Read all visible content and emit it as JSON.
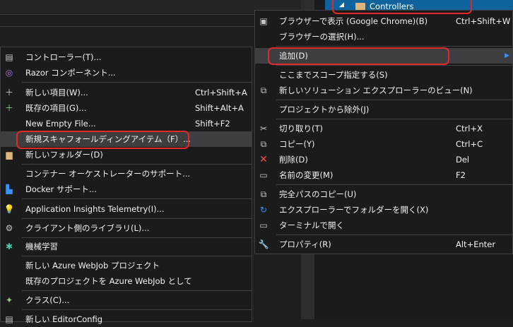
{
  "solution_explorer": {
    "selected_item": "Controllers"
  },
  "context_menu": {
    "items": [
      {
        "label": "ブラウザーで表示 (Google Chrome)(B)",
        "shortcut": "Ctrl+Shift+W",
        "icon": "browser-icon"
      },
      {
        "label": "ブラウザーの選択(H)...",
        "shortcut": "",
        "icon": ""
      },
      {
        "label": "追加(D)",
        "shortcut": "",
        "icon": "",
        "submenu": true
      },
      {
        "label": "ここまでスコープ指定する(S)",
        "shortcut": "",
        "icon": ""
      },
      {
        "label": "新しいソリューション エクスプローラーのビュー(N)",
        "shortcut": "",
        "icon": "new-view-icon"
      },
      {
        "label": "プロジェクトから除外(J)",
        "shortcut": "",
        "icon": ""
      },
      {
        "label": "切り取り(T)",
        "shortcut": "Ctrl+X",
        "icon": "scissors-icon"
      },
      {
        "label": "コピー(Y)",
        "shortcut": "Ctrl+C",
        "icon": "copy-icon"
      },
      {
        "label": "削除(D)",
        "shortcut": "Del",
        "icon": "delete-icon"
      },
      {
        "label": "名前の変更(M)",
        "shortcut": "F2",
        "icon": "rename-icon"
      },
      {
        "label": "完全パスのコピー(U)",
        "shortcut": "",
        "icon": "copy-path-icon"
      },
      {
        "label": "エクスプローラーでフォルダーを開く(X)",
        "shortcut": "",
        "icon": "refresh-icon"
      },
      {
        "label": "ターミナルで開く",
        "shortcut": "",
        "icon": "terminal-icon"
      },
      {
        "label": "プロパティ(R)",
        "shortcut": "Alt+Enter",
        "icon": "wrench-icon"
      }
    ]
  },
  "add_submenu": {
    "items": [
      {
        "label": "コントローラー(T)...",
        "shortcut": "",
        "icon": "controller-icon"
      },
      {
        "label": "Razor コンポーネント...",
        "shortcut": "",
        "icon": "razor-icon"
      },
      {
        "label": "新しい項目(W)...",
        "shortcut": "Ctrl+Shift+A",
        "icon": "new-item-icon"
      },
      {
        "label": "既存の項目(G)...",
        "shortcut": "Shift+Alt+A",
        "icon": "existing-item-icon"
      },
      {
        "label": "New Empty File...",
        "shortcut": "Shift+F2",
        "icon": ""
      },
      {
        "label": "新規スキャフォールディングアイテム（F）...",
        "shortcut": "",
        "icon": ""
      },
      {
        "label": "新しいフォルダー(D)",
        "shortcut": "",
        "icon": "new-folder-icon"
      },
      {
        "label": "コンテナー オーケストレーターのサポート...",
        "shortcut": "",
        "icon": ""
      },
      {
        "label": "Docker サポート...",
        "shortcut": "",
        "icon": "docker-icon"
      },
      {
        "label": "Application Insights Telemetry(I)...",
        "shortcut": "",
        "icon": "insights-icon"
      },
      {
        "label": "クライアント側のライブラリ(L)...",
        "shortcut": "",
        "icon": "library-icon"
      },
      {
        "label": "機械学習",
        "shortcut": "",
        "icon": "ml-icon"
      },
      {
        "label": "新しい Azure WebJob プロジェクト",
        "shortcut": "",
        "icon": ""
      },
      {
        "label": "既存のプロジェクトを Azure WebJob として",
        "shortcut": "",
        "icon": ""
      },
      {
        "label": "クラス(C)...",
        "shortcut": "",
        "icon": "class-icon"
      },
      {
        "label": "新しい EditorConfig",
        "shortcut": "",
        "icon": "editorconfig-icon"
      }
    ]
  }
}
